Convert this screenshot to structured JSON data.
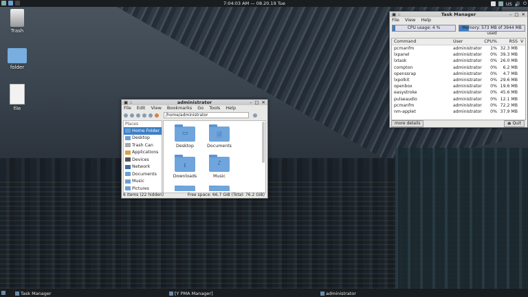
{
  "topbar": {
    "clock": "7:04:03 AM  —  08.20.19 Tue",
    "kbd": "US"
  },
  "desktop": {
    "trash_label": "Trash",
    "folder_label": "folder",
    "file_label": "file"
  },
  "file_manager": {
    "title": "administrator",
    "menu": [
      "File",
      "Edit",
      "View",
      "Bookmarks",
      "Go",
      "Tools",
      "Help"
    ],
    "path": "/home/administrator",
    "places_header": "Places",
    "places": [
      "Home Folder",
      "Desktop",
      "Trash Can",
      "Applications",
      "Devices",
      "Network",
      "Documents",
      "Music",
      "Pictures"
    ],
    "files": [
      "Desktop",
      "Documents",
      "Downloads",
      "Music",
      "",
      ""
    ],
    "status_left": "6 items (22 hidden)",
    "status_right": "Free space: 66.7 GiB (Total: 76.2 GiB)"
  },
  "task_manager": {
    "title": "Task Manager",
    "menu": [
      "File",
      "View",
      "Help"
    ],
    "cpu_label": "CPU usage: 4 %",
    "cpu_percent": 4,
    "mem_label": "Memory: 573 MB of 3944 MB used",
    "mem_fraction": 0.145,
    "columns": [
      "Command",
      "User",
      "CPU%",
      "RSS",
      "V"
    ],
    "rows": [
      [
        "pcmanfm",
        "administrator",
        "1%",
        "32.3 MB"
      ],
      [
        "lxpanel",
        "administrator",
        "0%",
        "39.3 MB"
      ],
      [
        "lxtask",
        "administrator",
        "0%",
        "26.0 MB"
      ],
      [
        "compton",
        "administrator",
        "0%",
        "6.2 MB"
      ],
      [
        "openssrap",
        "administrator",
        "0%",
        "4.7 MB"
      ],
      [
        "lxpolkit",
        "administrator",
        "0%",
        "29.6 MB"
      ],
      [
        "openbox",
        "administrator",
        "0%",
        "19.6 MB"
      ],
      [
        "easystroke",
        "administrator",
        "0%",
        "45.6 MB"
      ],
      [
        "pulseaudio",
        "administrator",
        "0%",
        "12.1 MB"
      ],
      [
        "pcmanfm",
        "administrator",
        "0%",
        "72.2 MB"
      ],
      [
        "nm-applet",
        "administrator",
        "0%",
        "37.9 MB"
      ]
    ],
    "more_details": "more details",
    "quit": "Quit"
  },
  "taskbar": {
    "task1": "Task Manager",
    "task2": "[Y PMA Manager]",
    "task3": "administrator"
  }
}
